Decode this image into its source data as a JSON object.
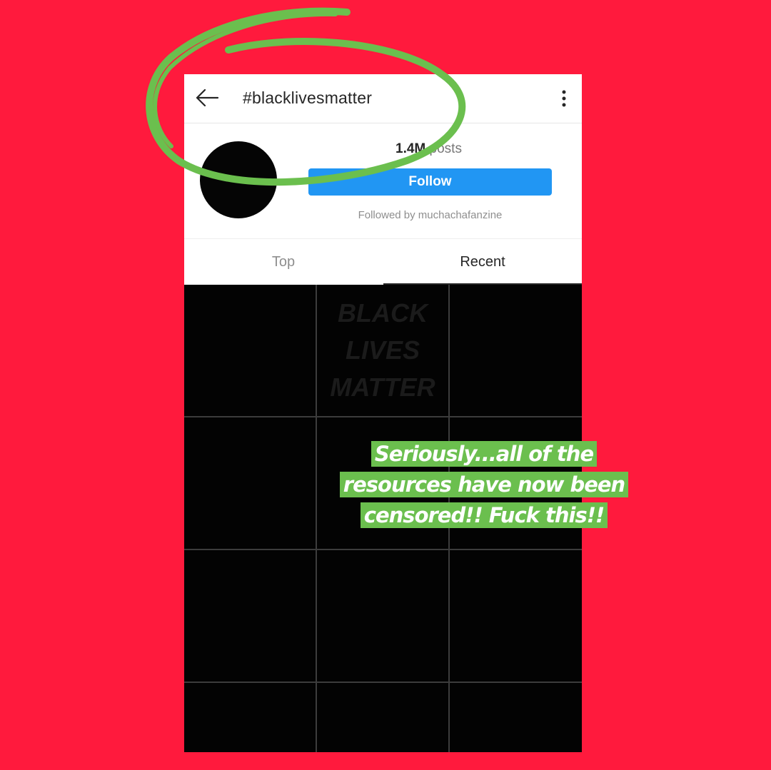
{
  "header": {
    "title": "#blacklivesmatter",
    "back_icon": "arrow-left-icon",
    "more_icon": "vertical-ellipsis-icon"
  },
  "profile": {
    "post_count_number": "1.4M",
    "post_count_label": "posts",
    "follow_label": "Follow",
    "followed_by": "Followed by muchachafanzine"
  },
  "tabs": [
    {
      "label": "Top"
    },
    {
      "label": "Recent"
    }
  ],
  "grid": {
    "tile_text": [
      "BLACK",
      "LIVES",
      "MATTER"
    ]
  },
  "overlay": {
    "caption_lines": [
      "Seriously...all of the",
      "resources have now been",
      "censored!! Fuck this!!"
    ]
  },
  "colors": {
    "background": "#ff1a3d",
    "follow_button": "#2196f3",
    "annotation_green": "#6bbf4e"
  }
}
